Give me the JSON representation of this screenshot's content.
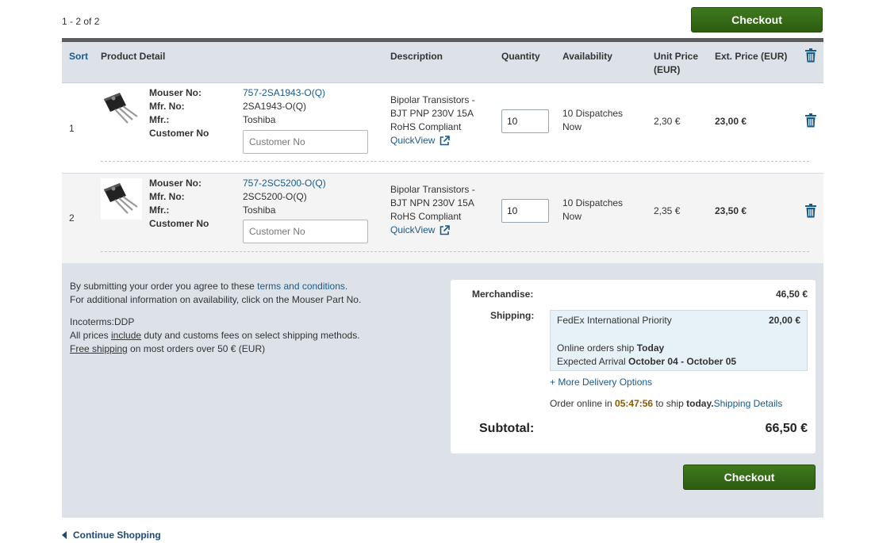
{
  "header": {
    "count": "1 - 2 of 2",
    "checkout_label": "Checkout"
  },
  "table": {
    "columns": {
      "sort": "Sort",
      "product_detail": "Product Detail",
      "description": "Description",
      "quantity": "Quantity",
      "availability": "Availability",
      "unit_price_1": "Unit Price",
      "unit_price_2": "(EUR)",
      "ext_price": "Ext. Price (EUR)"
    },
    "labels": {
      "mouser_no": "Mouser No:",
      "mfr_no": "Mfr. No:",
      "mfr": "Mfr.:",
      "customer_no": "Customer No",
      "customer_no_placeholder": "Customer No",
      "quickview": "QuickView"
    },
    "rows": [
      {
        "index": "1",
        "mouser_no": "757-2SA1943-O(Q)",
        "mfr_no": "2SA1943-O(Q)",
        "mfr": "Toshiba",
        "desc_line1": "Bipolar Transistors -",
        "desc_line2": "BJT PNP 230V 15A",
        "desc_line3": "RoHS Compliant",
        "quantity": "10",
        "avail_line1": "10  Dispatches",
        "avail_line2": "Now",
        "unit_price": "2,30 €",
        "ext_price": "23,00 €"
      },
      {
        "index": "2",
        "mouser_no": "757-2SC5200-O(Q)",
        "mfr_no": "2SC5200-O(Q)",
        "mfr": "Toshiba",
        "desc_line1": "Bipolar Transistors -",
        "desc_line2": "BJT NPN 230V 15A",
        "desc_line3": "RoHS Compliant",
        "quantity": "10",
        "avail_line1": "10  Dispatches",
        "avail_line2": "Now",
        "unit_price": "2,35 €",
        "ext_price": "23,50 €"
      }
    ]
  },
  "terms": {
    "line1_prefix": "By submitting your order you agree to these ",
    "line1_link": "terms and conditions.",
    "line2": "For additional information on availability, click on the Mouser Part No.",
    "incoterms": "Incoterms:DDP",
    "line4_prefix": "All prices ",
    "line4_link": "include",
    "line4_suffix": " duty and customs fees on select shipping methods.",
    "line5_link": "Free shipping",
    "line5_suffix": " on most orders over 50 € (EUR)"
  },
  "totals": {
    "merchandise_label": "Merchandise:",
    "merchandise_value": "46,50 €",
    "shipping_label": "Shipping:",
    "shipping_method": "FedEx International Priority",
    "shipping_cost": "20,00 €",
    "ship_prefix": "Online orders ship ",
    "ship_today": "Today",
    "arrival_prefix": "Expected Arrival ",
    "arrival_dates": "October 04 - October 05",
    "more_options": "+ More Delivery Options",
    "order_prefix": "Order online in ",
    "countdown": "05:47:56",
    "order_mid": " to ship ",
    "order_today": "today.",
    "shipping_details": "Shipping Details",
    "subtotal_label": "Subtotal:",
    "subtotal_value": "66,50 €"
  },
  "footer": {
    "continue_shopping": "Continue Shopping"
  },
  "colors": {
    "checkout_green": "#3f7a1e",
    "link_blue": "#1a5a8a",
    "countdown_orange": "#8a5a00",
    "header_bg": "#dde2e8"
  }
}
